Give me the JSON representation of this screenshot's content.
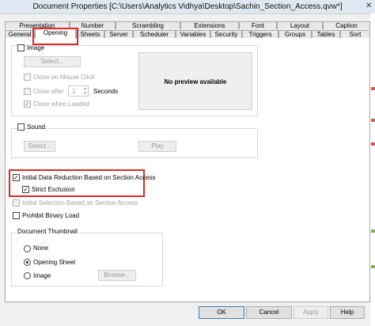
{
  "window": {
    "title": "Document Properties [C:\\Users\\Analytics Vidhya\\Desktop\\Sachin_Section_Access.qvw*]",
    "close_glyph": "✕"
  },
  "tabs": {
    "row1": [
      "Presentation",
      "Number",
      "Scrambling",
      "Extensions",
      "Font",
      "Layout",
      "Caption"
    ],
    "row2": [
      "General",
      "Opening",
      "Sheets",
      "Server",
      "Scheduler",
      "Variables",
      "Security",
      "Triggers",
      "Groups",
      "Tables",
      "Sort"
    ],
    "active": "Opening"
  },
  "image_group": {
    "checkbox_label": "Image",
    "select_button": "Select...",
    "close_on_mouse_click": "Close on Mouse Click",
    "close_after": "Close after",
    "seconds_value": "1",
    "seconds_label": "Seconds",
    "close_when_loaded": "Close when Loaded",
    "preview_text": "No preview available"
  },
  "sound_group": {
    "checkbox_label": "Sound",
    "select_button": "Select...",
    "play_button": "Play"
  },
  "reduction": {
    "initial_data_reduction": "Initial Data Reduction Based on Section Access",
    "strict_exclusion": "Strict Exclusion",
    "initial_selection": "Initial Selection Based on Section Access",
    "prohibit_binary_load": "Prohibit Binary Load"
  },
  "thumbnail": {
    "group_title": "Document Thumbnail",
    "options": [
      "None",
      "Opening Sheet",
      "Image"
    ],
    "selected": "Opening Sheet",
    "browse_button": "Browse..."
  },
  "footer": {
    "ok": "OK",
    "cancel": "Cancel",
    "apply": "Apply",
    "help": "Help"
  }
}
